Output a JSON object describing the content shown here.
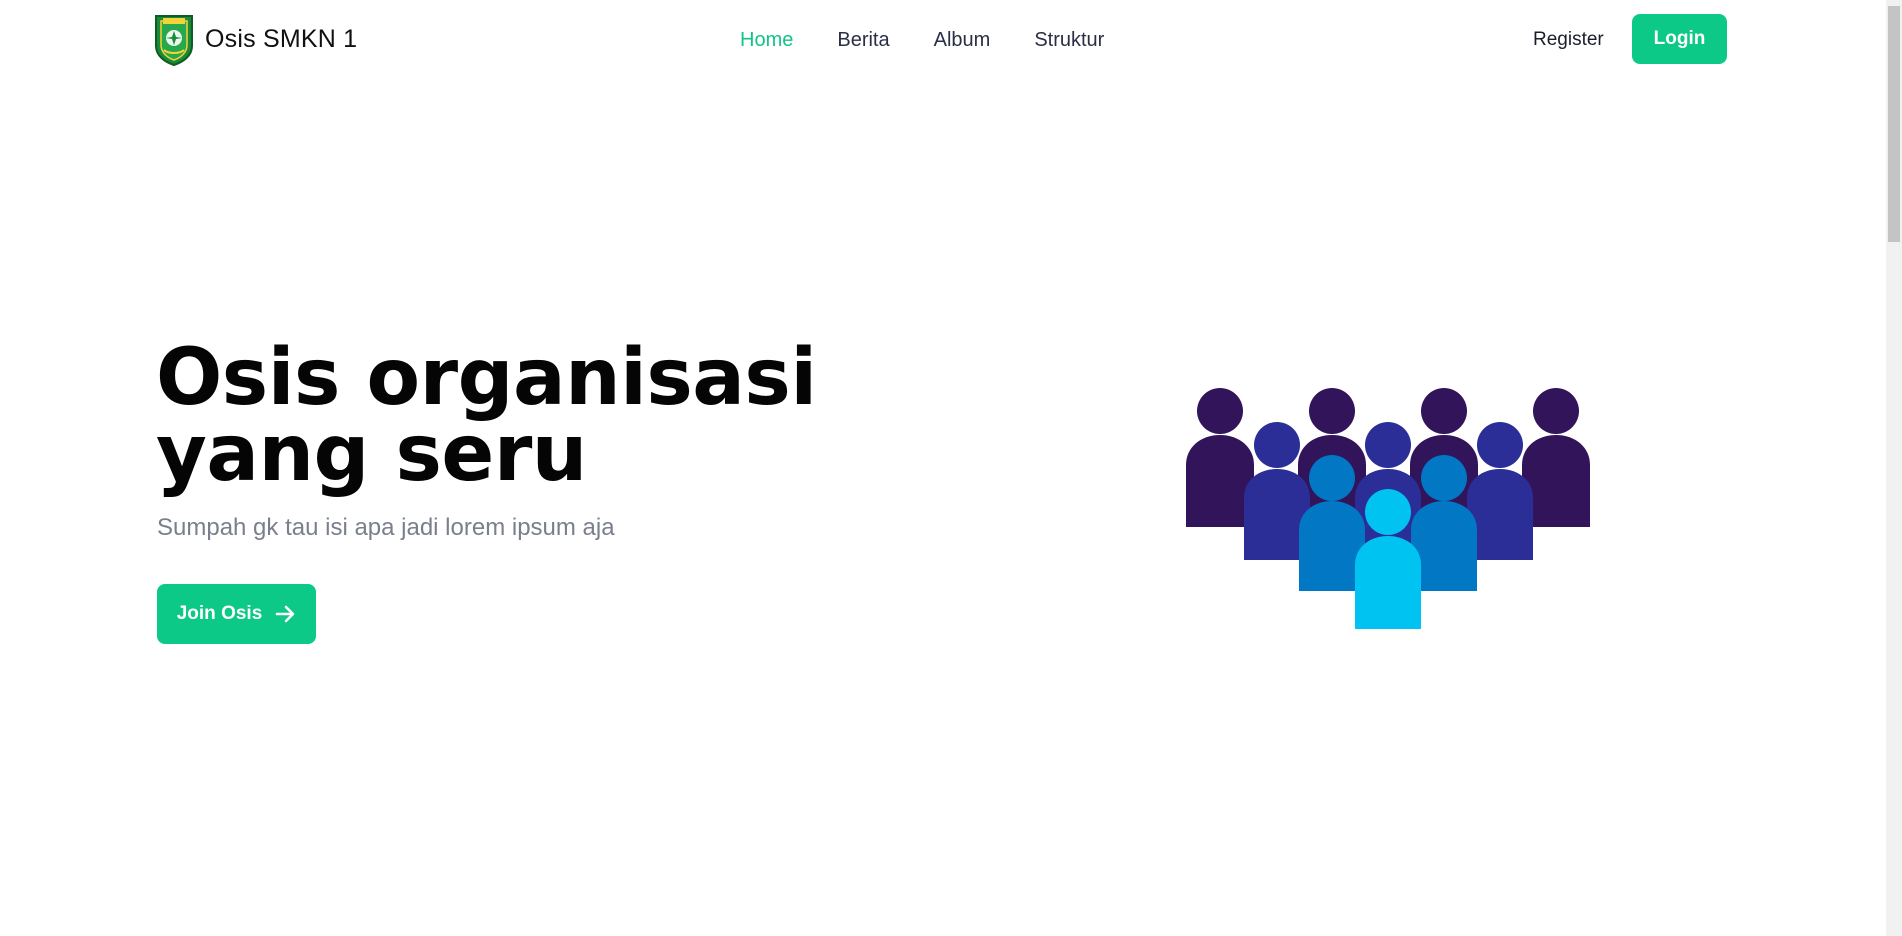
{
  "navbar": {
    "brand_name": "Osis SMKN 1",
    "links": [
      {
        "label": "Home",
        "active": true
      },
      {
        "label": "Berita",
        "active": false
      },
      {
        "label": "Album",
        "active": false
      },
      {
        "label": "Struktur",
        "active": false
      }
    ],
    "register_label": "Register",
    "login_label": "Login"
  },
  "hero": {
    "title": "Osis organisasi yang seru",
    "subtitle": "Sumpah gk tau isi apa jadi lorem ipsum aja",
    "cta_label": "Join Osis",
    "cta_icon": "arrow-right-icon",
    "illustration": "group-of-people"
  },
  "colors": {
    "accent": "#0cc988",
    "active_link": "#12c38a",
    "people_dark_purple": "#32145a",
    "people_indigo": "#2b2e96",
    "people_blue": "#0277c4",
    "people_cyan": "#00c3f2"
  }
}
